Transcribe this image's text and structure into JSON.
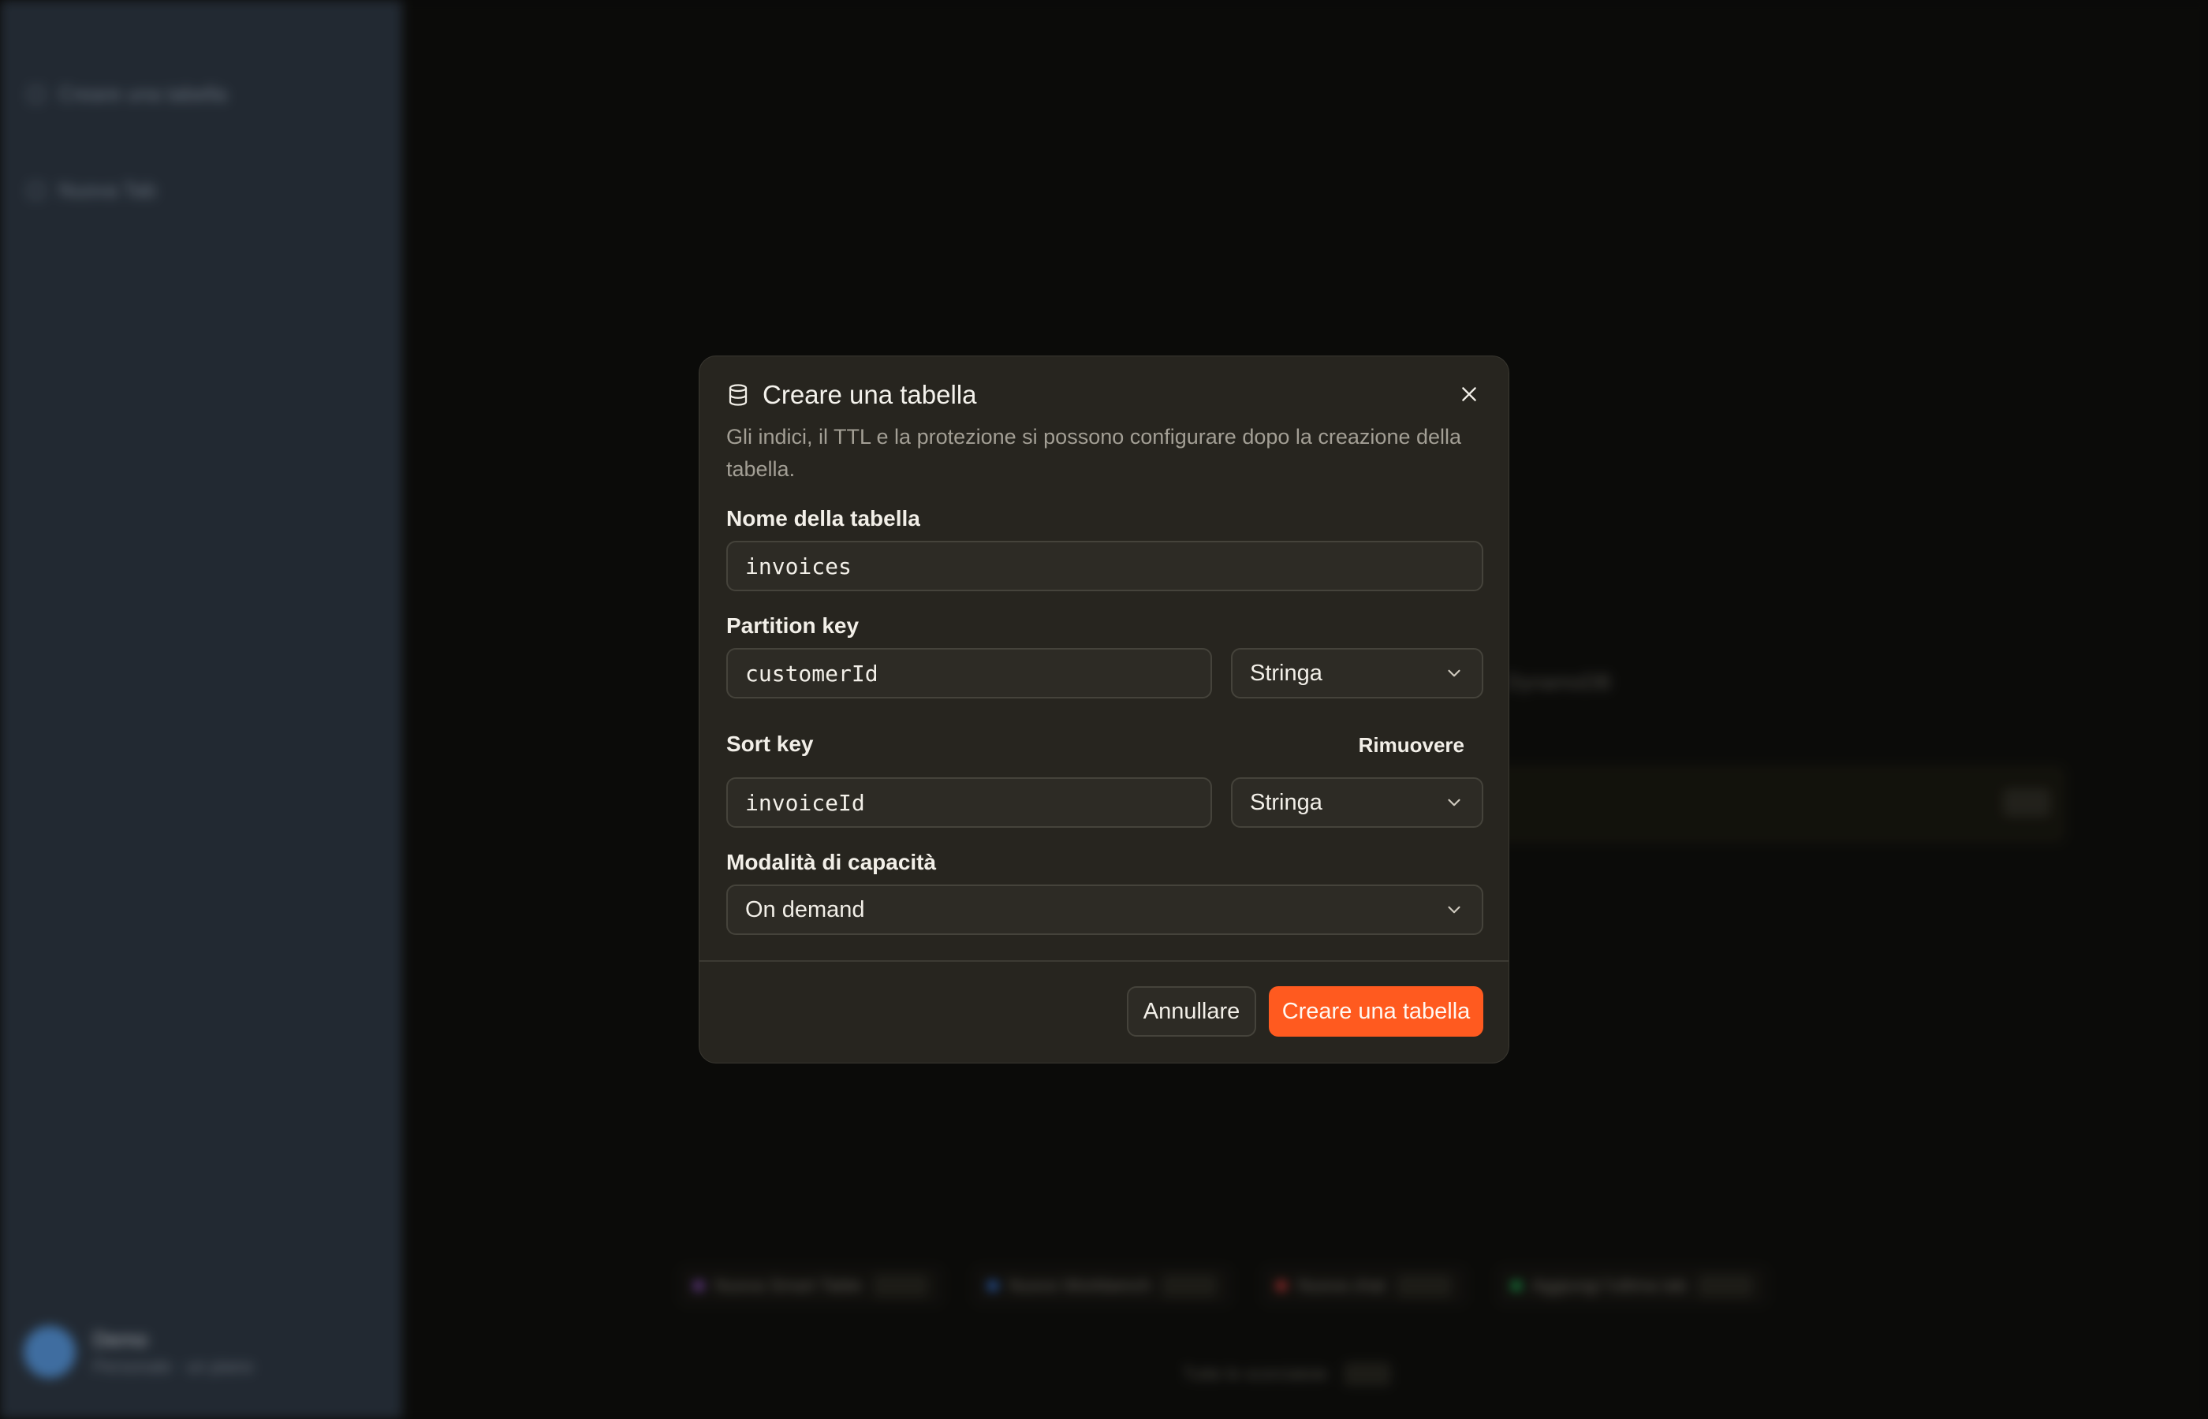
{
  "sidebar": {
    "items": [
      {
        "label": "Creare una tabella",
        "icon": "plus-icon"
      },
      {
        "label": "Nuova Tab",
        "icon": "plus-icon"
      }
    ],
    "user": {
      "name": "Demo",
      "subtitle": "Personale · un piano"
    }
  },
  "background": {
    "note": "DynamoDB",
    "chips": [
      {
        "label": "Nuova Smart Table",
        "color": "#9b59d6"
      },
      {
        "label": "Nuovo Workbench",
        "color": "#3b82f6"
      },
      {
        "label": "Nuova chat",
        "color": "#ef4444"
      },
      {
        "label": "Aggiungi l'ultima tab",
        "color": "#22c55e"
      }
    ],
    "footer": "Tutte le scorciatoie"
  },
  "modal": {
    "title": "Creare una tabella",
    "title_icon": "database-icon",
    "description": "Gli indici, il TTL e la protezione si possono configurare dopo la creazione della tabella.",
    "table_name": {
      "label": "Nome della tabella",
      "value": "invoices"
    },
    "partition_key": {
      "label": "Partition key",
      "value": "customerId",
      "type": "Stringa"
    },
    "sort_key": {
      "label": "Sort key",
      "value": "invoiceId",
      "type": "Stringa",
      "remove_label": "Rimuovere"
    },
    "capacity": {
      "label": "Modalità di capacità",
      "value": "On demand"
    },
    "cancel_label": "Annullare",
    "submit_label": "Creare una tabella",
    "accent_color": "#ff5a1f"
  }
}
